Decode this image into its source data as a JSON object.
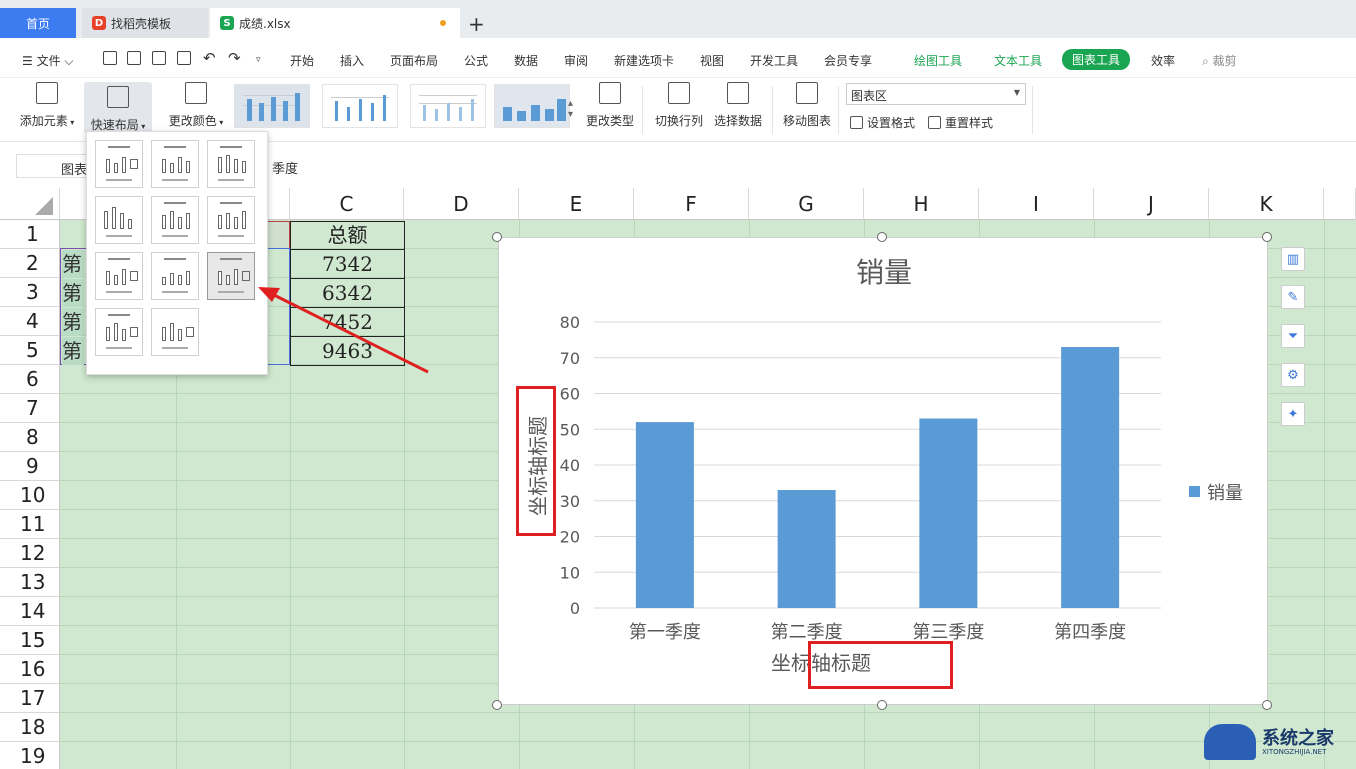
{
  "tabs": {
    "home": "首页",
    "template": "找稻壳模板",
    "file": "成绩.xlsx",
    "add": "+"
  },
  "menu": {
    "file": "文件",
    "items": [
      "开始",
      "插入",
      "页面布局",
      "公式",
      "数据",
      "审阅",
      "新建选项卡",
      "视图",
      "开发工具",
      "会员专享"
    ],
    "drawing_tools": "绘图工具",
    "text_tools": "文本工具",
    "chart_tools": "图表工具",
    "efficiency": "效率",
    "crop": "裁剪"
  },
  "ribbon": {
    "add_element": "添加元素",
    "quick_layout": "快速布局",
    "change_color": "更改颜色",
    "change_type": "更改类型",
    "switch_rowcol": "切换行列",
    "select_data": "选择数据",
    "move_chart": "移动图表",
    "area_select": "图表区",
    "set_format": "设置格式",
    "reset_style": "重置样式"
  },
  "formula": {
    "name_box": "图表",
    "text": "季度"
  },
  "sheet": {
    "columns": [
      "C",
      "D",
      "E",
      "F",
      "G",
      "H",
      "I",
      "J",
      "K"
    ],
    "rows": [
      "1",
      "2",
      "3",
      "4",
      "5",
      "6",
      "7",
      "8",
      "9",
      "10",
      "11",
      "12",
      "13",
      "14",
      "15",
      "16",
      "17",
      "18",
      "19"
    ],
    "header_c1": "总额",
    "values_c": [
      "7342",
      "6342",
      "7452",
      "9463"
    ],
    "partial_a": [
      "第",
      "第",
      "第",
      "第"
    ]
  },
  "chart_data": {
    "type": "bar",
    "title": "销量",
    "categories": [
      "第一季度",
      "第二季度",
      "第三季度",
      "第四季度"
    ],
    "series": [
      {
        "name": "销量",
        "values": [
          52,
          33,
          53,
          73
        ]
      }
    ],
    "ylim": [
      0,
      80
    ],
    "yticks": [
      "0",
      "10",
      "20",
      "30",
      "40",
      "50",
      "60",
      "70",
      "80"
    ],
    "xlabel": "坐标轴标题",
    "ylabel": "坐标轴标题",
    "grid": true,
    "legend": "right",
    "bar_color": "#5b9bd5"
  },
  "watermark": {
    "name": "系统之家",
    "url": "XITONGZHIJIA.NET"
  }
}
